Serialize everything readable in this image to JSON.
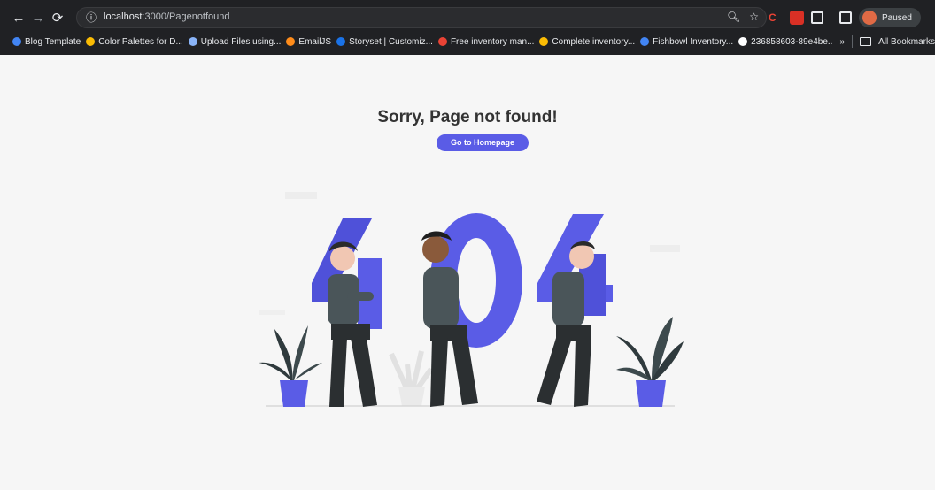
{
  "browser": {
    "url_host": "localhost",
    "url_path": ":3000/Pagenotfound",
    "profile_status": "Paused",
    "bookmarks": [
      {
        "label": "Blog Template",
        "color": "#4285f4"
      },
      {
        "label": "Color Palettes for D...",
        "color": "#fbbc04"
      },
      {
        "label": "Upload Files using...",
        "color": "#8ab4f8"
      },
      {
        "label": "EmailJS",
        "color": "#ff8c1a"
      },
      {
        "label": "Storyset | Customiz...",
        "color": "#1a73e8"
      },
      {
        "label": "Free inventory man...",
        "color": "#ea4335"
      },
      {
        "label": "Complete inventory...",
        "color": "#fbbc04"
      },
      {
        "label": "Fishbowl Inventory...",
        "color": "#4285f4"
      },
      {
        "label": "236858603-89e4be...",
        "color": "#ffffff"
      }
    ],
    "all_bookmarks_label": "All Bookmarks",
    "more_chevron": "»"
  },
  "page": {
    "title": "Sorry, Page not found!",
    "button_label": "Go to Homepage",
    "accent_color": "#5a5ce6"
  }
}
